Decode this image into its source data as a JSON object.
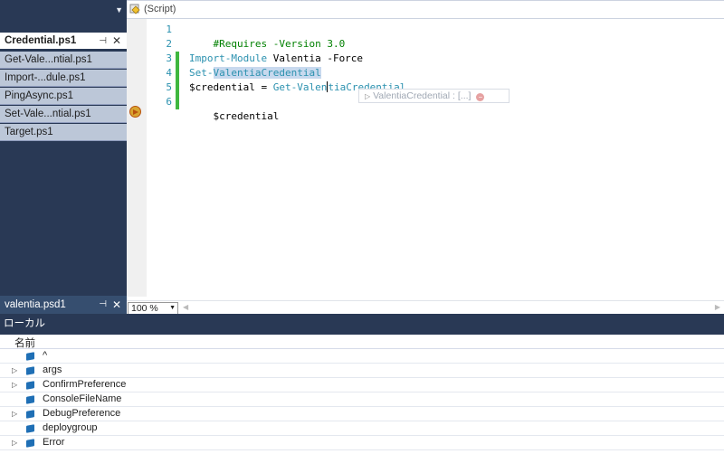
{
  "file_tabs": [
    {
      "label": "Credential.ps1",
      "active": true
    },
    {
      "label": "Get-Vale...ntial.ps1",
      "active": false
    },
    {
      "label": "Import-...dule.ps1",
      "active": false
    },
    {
      "label": "PingAsync.ps1",
      "active": false
    },
    {
      "label": "Set-Vale...ntial.ps1",
      "active": false
    },
    {
      "label": "Target.ps1",
      "active": false
    }
  ],
  "bottom_file": {
    "label": "valentia.psd1"
  },
  "editor": {
    "scope_label": "(Script)",
    "line_numbers": [
      "1",
      "2",
      "3",
      "4",
      "5",
      "6"
    ],
    "lines": {
      "l1": "#Requires -Version 3.0",
      "l3a": "Import-Module",
      "l3b": " Valentia -Force",
      "l4a": "Set-",
      "l4b": "ValentiaCredential",
      "l5a": "$credential = ",
      "l5b": "Get-Valen",
      "l5c": "tiaCredential",
      "l6": "$credential"
    },
    "datatip": "ValentiaCredential : [...]",
    "zoom": "100 %"
  },
  "locals": {
    "title": "ローカル",
    "column_name": "名前",
    "rows": [
      {
        "name": "^",
        "expandable": false
      },
      {
        "name": "args",
        "expandable": true
      },
      {
        "name": "ConfirmPreference",
        "expandable": true
      },
      {
        "name": "ConsoleFileName",
        "expandable": false
      },
      {
        "name": "DebugPreference",
        "expandable": true
      },
      {
        "name": "deploygroup",
        "expandable": false
      },
      {
        "name": "Error",
        "expandable": true
      }
    ]
  },
  "colors": {
    "panel_dark": "#293955",
    "tab_inactive": "#bcc7d8",
    "line_number": "#2b91af",
    "comment": "#008000",
    "changed_bar": "#3fb73f"
  }
}
